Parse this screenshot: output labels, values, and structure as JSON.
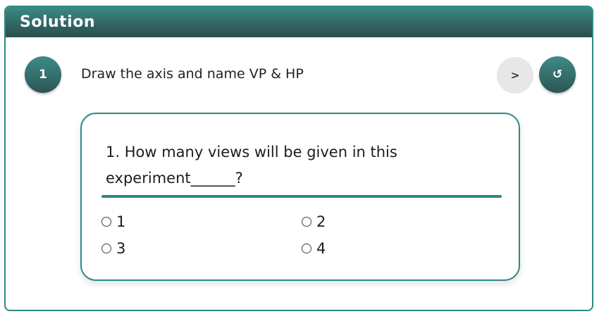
{
  "panel": {
    "title": "Solution"
  },
  "step": {
    "number": "1",
    "text": "Draw the axis and name VP & HP",
    "next_label": ">",
    "reset_label": "↺"
  },
  "question": {
    "text": "1. How many views will be given in this experiment______?",
    "options": [
      {
        "label": "1"
      },
      {
        "label": "2"
      },
      {
        "label": "3"
      },
      {
        "label": "4"
      }
    ]
  },
  "colors": {
    "accent": "#2b8a86",
    "header_dark": "#2f5e5c",
    "next_button_bg": "#e9e6e6"
  }
}
